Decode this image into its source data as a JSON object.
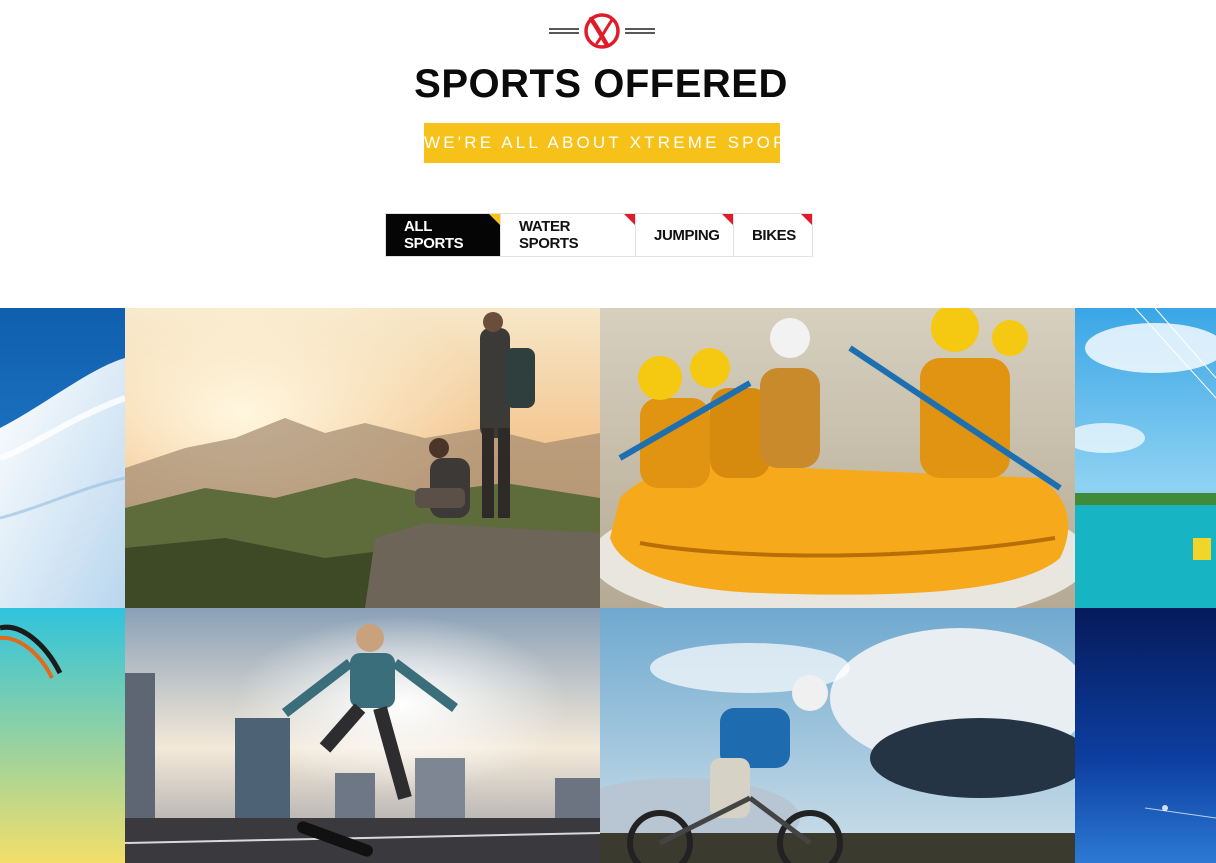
{
  "header": {
    "logo_icon": "xtreme-x-logo-icon",
    "title": "SPORTS OFFERED",
    "subtitle": "WE'RE ALL ABOUT XTREME SPORTS",
    "accent_yellow": "#f6c21a",
    "accent_red": "#e01b2a"
  },
  "filters": {
    "items": [
      {
        "label": "ALL SPORTS",
        "active": true
      },
      {
        "label": "WATER SPORTS",
        "active": false
      },
      {
        "label": "JUMPING",
        "active": false
      },
      {
        "label": "BIKES",
        "active": false
      }
    ]
  },
  "gallery": {
    "tiles": [
      {
        "name": "snowboard-photo"
      },
      {
        "name": "hiking-couple-photo"
      },
      {
        "name": "white-water-rafting-photo"
      },
      {
        "name": "kitesurf-beach-photo"
      },
      {
        "name": "paraglide-sky-photo"
      },
      {
        "name": "skateboard-jump-photo"
      },
      {
        "name": "mountain-bike-photo"
      },
      {
        "name": "night-sky-kite-photo"
      }
    ]
  }
}
